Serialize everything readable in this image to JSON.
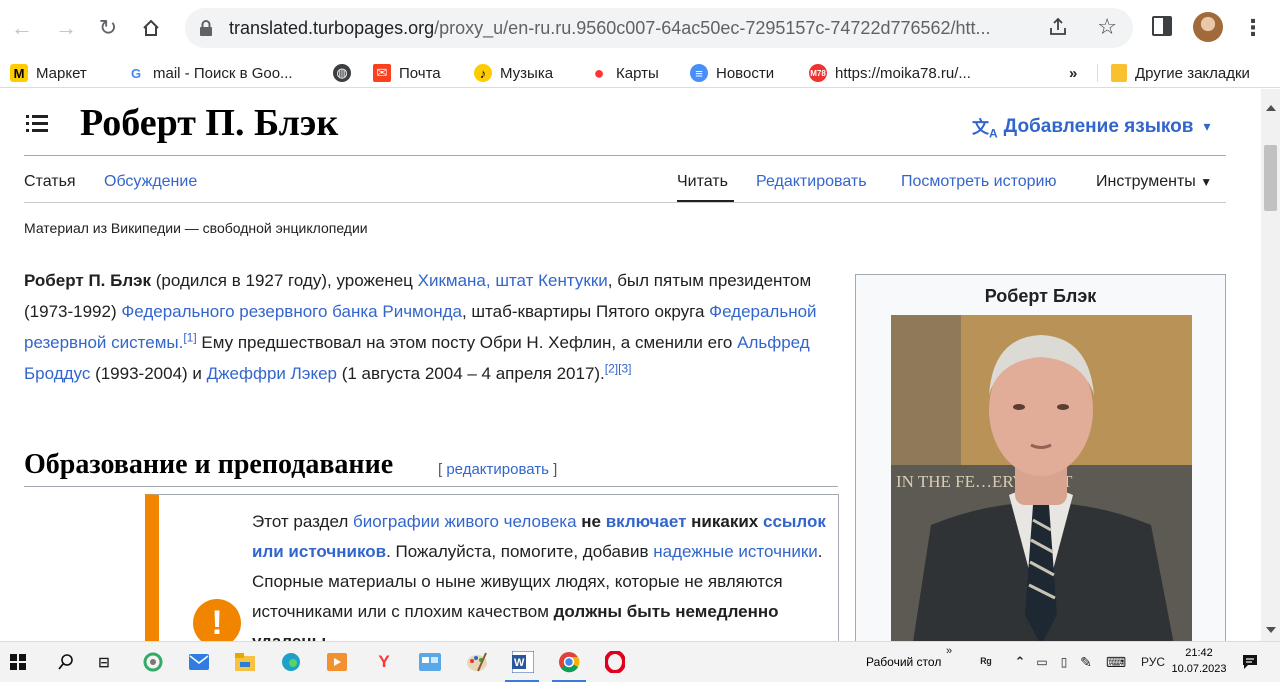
{
  "browser": {
    "url_host": "translated.turbopages.org",
    "url_path": "/proxy_u/en-ru.ru.9560c007-64ac50ec-7295157c-74722d776562/htt...",
    "bookmarks": [
      {
        "label": "Маркет",
        "icon": "market-icon",
        "color": "#fc0"
      },
      {
        "label": "mail - Поиск в Goo...",
        "icon": "google-icon",
        "color": "#4285f4"
      },
      {
        "label": "",
        "icon": "globe-icon",
        "color": "#3c4043"
      },
      {
        "label": "Почта",
        "icon": "mail-icon",
        "color": "#fc3f1d"
      },
      {
        "label": "Музыка",
        "icon": "music-icon",
        "color": "#fc0"
      },
      {
        "label": "Карты",
        "icon": "maps-icon",
        "color": "#f33"
      },
      {
        "label": "Новости",
        "icon": "news-icon",
        "color": "#4a8ff7"
      },
      {
        "label": "https://moika78.ru/...",
        "icon": "m78-icon",
        "color": "#e33"
      }
    ],
    "overflow": "»",
    "other_bookmarks": "Другие закладки"
  },
  "article": {
    "title": "Роберт П. Блэк",
    "add_languages": "Добавление языков",
    "tabs": {
      "article": "Статья",
      "talk": "Обсуждение",
      "read": "Читать",
      "edit": "Редактировать",
      "history": "Посмотреть историю",
      "tools": "Инструменты"
    },
    "tagline": "Материал из Википедии — свободной энциклопедии",
    "lead": {
      "name": "Роберт П. Блэк",
      "t1": " (родился в 1927 году), уроженец ",
      "l1": "Хикмана, штат Кентукки",
      "t2": ", был пятым президентом (1973-1992) ",
      "l2": "Федерального резервного банка Ричмонда",
      "t3": ", штаб-квартиры Пятого округа ",
      "l3": "Федеральной резервной системы.",
      "r1": "[1]",
      "t4": " Ему предшествовал на этом посту Обри Н. Хефлин, а сменили его ",
      "l4": "Альфред Броддус",
      "t5": " (1993-2004) и ",
      "l5": "Джеффри Лэкер",
      "t6": " (1 августа 2004 – 4 апреля 2017).",
      "r2": "[2]",
      "r3": "[3]"
    },
    "infobox_title": "Роберт Блэк",
    "photo_inscription": "IN THE FE…ERVE ACT",
    "section_heading": "Образование и преподавание",
    "section_edit_open": "[ ",
    "section_edit": "редактировать",
    "section_edit_close": " ]",
    "ambox": {
      "t1": "Этот раздел ",
      "l1": "биографии живого человека",
      "b1": " не ",
      "l2": "включает",
      "b2": " никаких ",
      "l3": "ссылок или источников",
      "t2": ". Пожалуйста, помогите, добавив ",
      "l4": "надежные источники",
      "t3": ". Спорные материалы о ныне живущих людях, которые не являются источниками или с плохим качеством ",
      "b3": " должны быть немедленно удалены",
      "t4": "."
    }
  },
  "taskbar": {
    "desktop": "Рабочий стол",
    "chevron": "»",
    "lang": "РУС",
    "time": "21:42",
    "date": "10.07.2023"
  }
}
